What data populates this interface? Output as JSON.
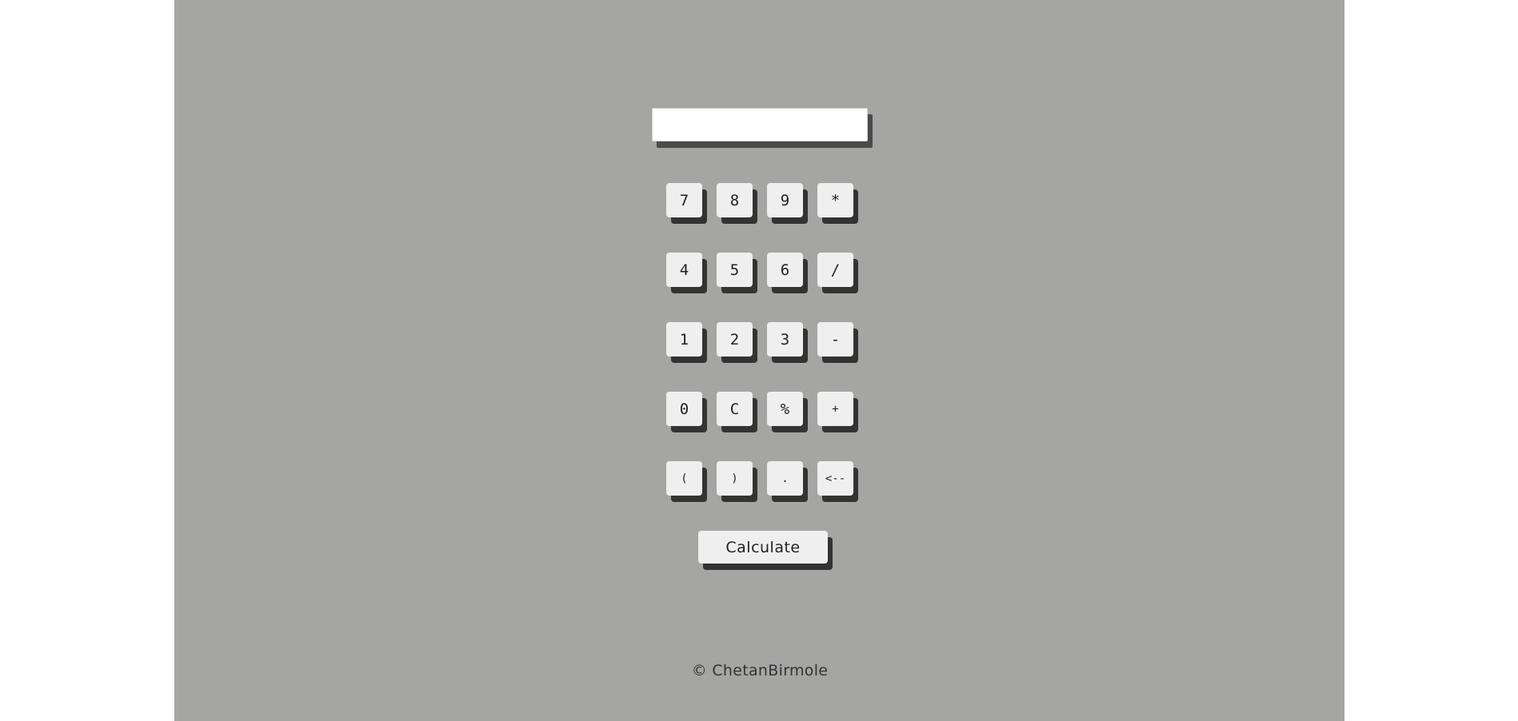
{
  "display": {
    "value": "",
    "placeholder": ""
  },
  "keys": {
    "row1": [
      "7",
      "8",
      "9",
      "*"
    ],
    "row2": [
      "4",
      "5",
      "6",
      "/"
    ],
    "row3": [
      "1",
      "2",
      "3",
      "-"
    ],
    "row4": [
      "0",
      "C",
      "%",
      "+"
    ],
    "row5": [
      "(",
      ")",
      ".",
      "<--"
    ]
  },
  "calculate_label": "Calculate",
  "footer": {
    "text": "© ChetanBirmole"
  },
  "colors": {
    "page_bg": "#ffffff",
    "panel_bg": "#a5a5a4",
    "key_bg": "#efefef",
    "key_shadow": "#333333",
    "display_shadow": "#4a4a4a"
  }
}
